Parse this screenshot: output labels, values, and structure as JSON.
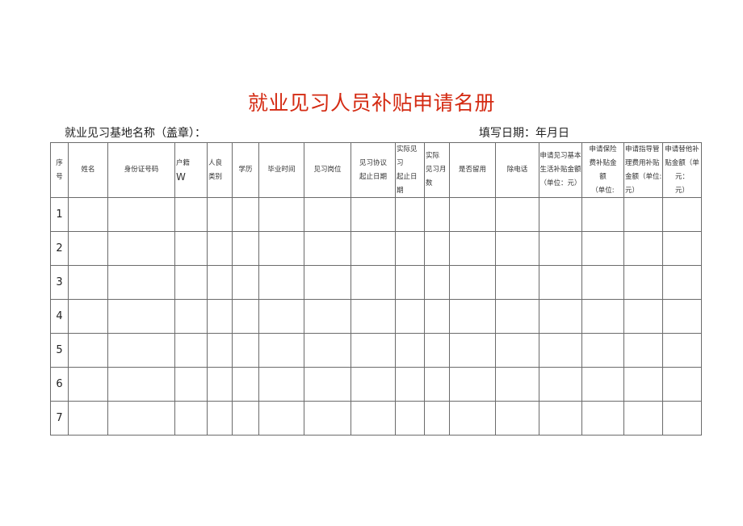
{
  "document": {
    "title": "就业见习人员补贴申请名册",
    "base_name_label": "就业见习基地名称（盖章）：",
    "fill_date_label": "填写日期：年月日",
    "title_color": "#d42a12"
  },
  "table": {
    "headers": [
      "序号",
      "姓名",
      "身份证号码",
      "户籍W",
      "人良类别",
      "学历",
      "毕业时间",
      "见习岗位",
      "见习协议起止日期",
      "实际见习起止日期",
      "实际见习月数",
      "是否留用",
      "除电话",
      "申请见习基本生活补贴金额（单位：元）",
      "申请保险费补贴金额（单位:",
      "申请指导管理费用补贴金额（单位:元）",
      "申请替他补贴金额（单元：元）"
    ],
    "header_lines": [
      [
        "序",
        "号"
      ],
      [
        "姓名"
      ],
      [
        "身份证号码"
      ],
      [
        "户籍",
        "W"
      ],
      [
        "人良",
        "类别"
      ],
      [
        "学历"
      ],
      [
        "毕业时间"
      ],
      [
        "见习岗位"
      ],
      [
        "见习协议",
        "起止日期"
      ],
      [
        "实际见",
        "习",
        "起止日",
        "期"
      ],
      [
        "实际",
        "见习月",
        "数"
      ],
      [
        "是否留用"
      ],
      [
        "除电话"
      ],
      [
        "申请见习基本",
        "生活补贴金额",
        "（单位：元）"
      ],
      [
        "申请保险",
        "费补贴金",
        "额",
        "（单位:"
      ],
      [
        "申请指导管",
        "理费用补贴",
        "金额（单位:",
        "元）"
      ],
      [
        "申请替他补",
        "贴金额（单",
        "元：",
        "元）"
      ]
    ],
    "rows": [
      {
        "index": "1",
        "cells": [
          "",
          "",
          "",
          "",
          "",
          "",
          "",
          "",
          "",
          "",
          "",
          "",
          "",
          "",
          "",
          ""
        ]
      },
      {
        "index": "2",
        "cells": [
          "",
          "",
          "",
          "",
          "",
          "",
          "",
          "",
          "",
          "",
          "",
          "",
          "",
          "",
          "",
          ""
        ]
      },
      {
        "index": "3",
        "cells": [
          "",
          "",
          "",
          "",
          "",
          "",
          "",
          "",
          "",
          "",
          "",
          "",
          "",
          "",
          "",
          ""
        ]
      },
      {
        "index": "4",
        "cells": [
          "",
          "",
          "",
          "",
          "",
          "",
          "",
          "",
          "",
          "",
          "",
          "",
          "",
          "",
          "",
          ""
        ]
      },
      {
        "index": "5",
        "cells": [
          "",
          "",
          "",
          "",
          "",
          "",
          "",
          "",
          "",
          "",
          "",
          "",
          "",
          "",
          "",
          ""
        ]
      },
      {
        "index": "6",
        "cells": [
          "",
          "",
          "",
          "",
          "",
          "",
          "",
          "",
          "",
          "",
          "",
          "",
          "",
          "",
          "",
          ""
        ]
      },
      {
        "index": "7",
        "cells": [
          "",
          "",
          "",
          "",
          "",
          "",
          "",
          "",
          "",
          "",
          "",
          "",
          "",
          "",
          "",
          ""
        ]
      }
    ]
  }
}
